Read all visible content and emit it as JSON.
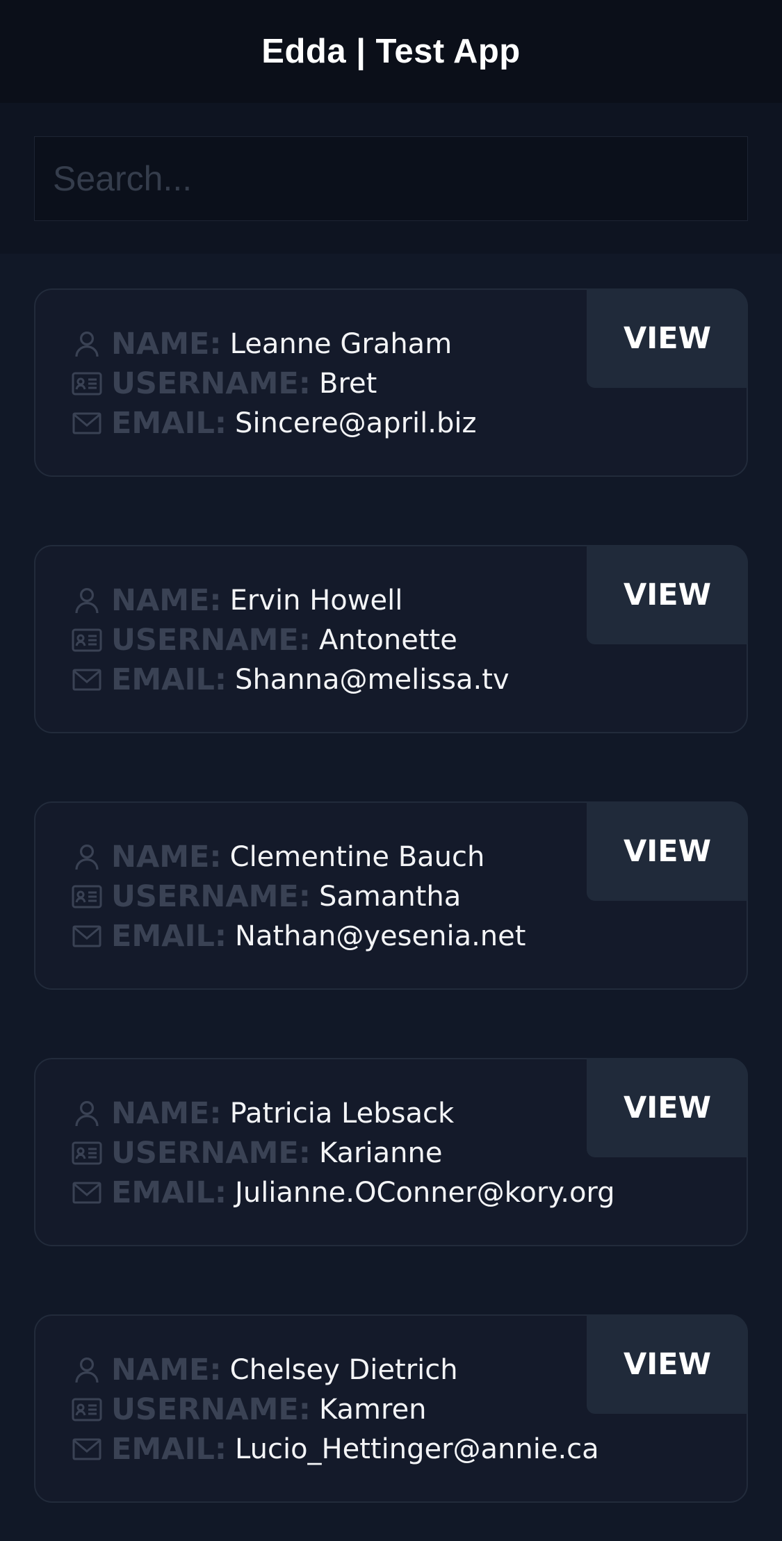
{
  "header": {
    "title": "Edda | Test App"
  },
  "search": {
    "placeholder": "Search..."
  },
  "labels": {
    "name": "NAME:",
    "username": "USERNAME:",
    "email": "EMAIL:"
  },
  "colors": {
    "background": "#111827",
    "card": "#141a2a",
    "button": "#202a3a",
    "label": "#3a4254"
  },
  "icons": {
    "name": "user-icon",
    "username": "id-card-icon",
    "email": "envelope-icon"
  },
  "users": [
    {
      "name": "Leanne Graham",
      "username": "Bret",
      "email": "Sincere@april.biz",
      "action": "VIEW"
    },
    {
      "name": "Ervin Howell",
      "username": "Antonette",
      "email": "Shanna@melissa.tv",
      "action": "VIEW"
    },
    {
      "name": "Clementine Bauch",
      "username": "Samantha",
      "email": "Nathan@yesenia.net",
      "action": "VIEW"
    },
    {
      "name": "Patricia Lebsack",
      "username": "Karianne",
      "email": "Julianne.OConner@kory.org",
      "action": "VIEW"
    },
    {
      "name": "Chelsey Dietrich",
      "username": "Kamren",
      "email": "Lucio_Hettinger@annie.ca",
      "action": "VIEW"
    }
  ]
}
